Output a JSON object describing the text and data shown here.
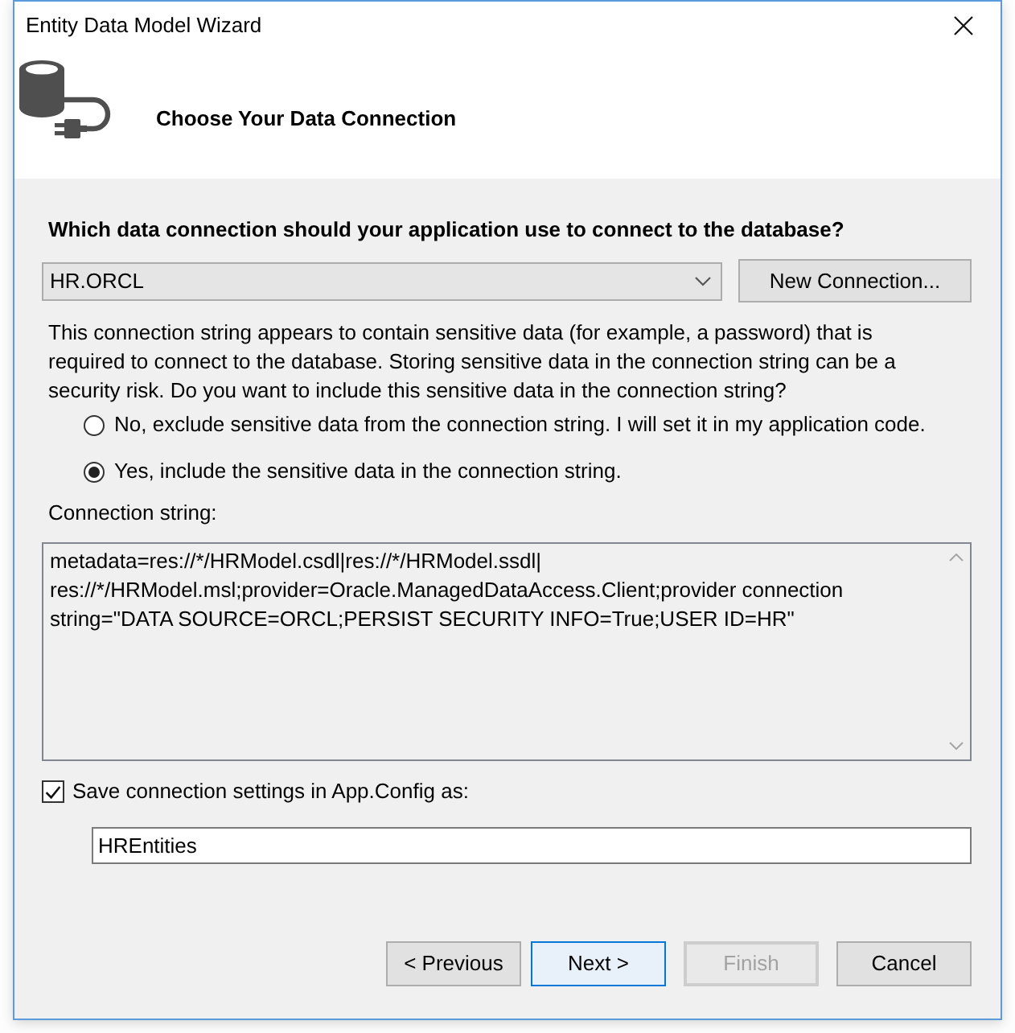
{
  "window": {
    "title": "Entity Data Model Wizard"
  },
  "header": {
    "title": "Choose Your Data Connection"
  },
  "question": "Which data connection should your application use to connect to the database?",
  "connection": {
    "value": "HR.ORCL",
    "new_connection_button": "New Connection..."
  },
  "warning": "This connection string appears to contain sensitive data (for example, a password) that is required to connect to the database. Storing sensitive data in the connection string can be a security risk. Do you want to include this sensitive data in the connection string?",
  "sensitive_data_options": [
    {
      "label": "No, exclude sensitive data from the connection string. I will set it in my application code.",
      "selected": false
    },
    {
      "label": "Yes, include the sensitive data in the connection string.",
      "selected": true
    }
  ],
  "connection_string": {
    "label": "Connection string:",
    "value": "metadata=res://*/HRModel.csdl|res://*/HRModel.ssdl|res://*/HRModel.msl;provider=Oracle.ManagedDataAccess.Client;provider connection string=\"DATA SOURCE=ORCL;PERSIST SECURITY INFO=True;USER ID=HR\""
  },
  "save_settings": {
    "label": "Save connection settings in App.Config as:",
    "checked": true,
    "value": "HREntities"
  },
  "buttons": [
    {
      "label": "< Previous",
      "disabled": false,
      "default": false
    },
    {
      "label": "Next >",
      "disabled": false,
      "default": true
    },
    {
      "label": "Finish",
      "disabled": true,
      "default": false
    },
    {
      "label": "Cancel",
      "disabled": false,
      "default": false
    }
  ]
}
